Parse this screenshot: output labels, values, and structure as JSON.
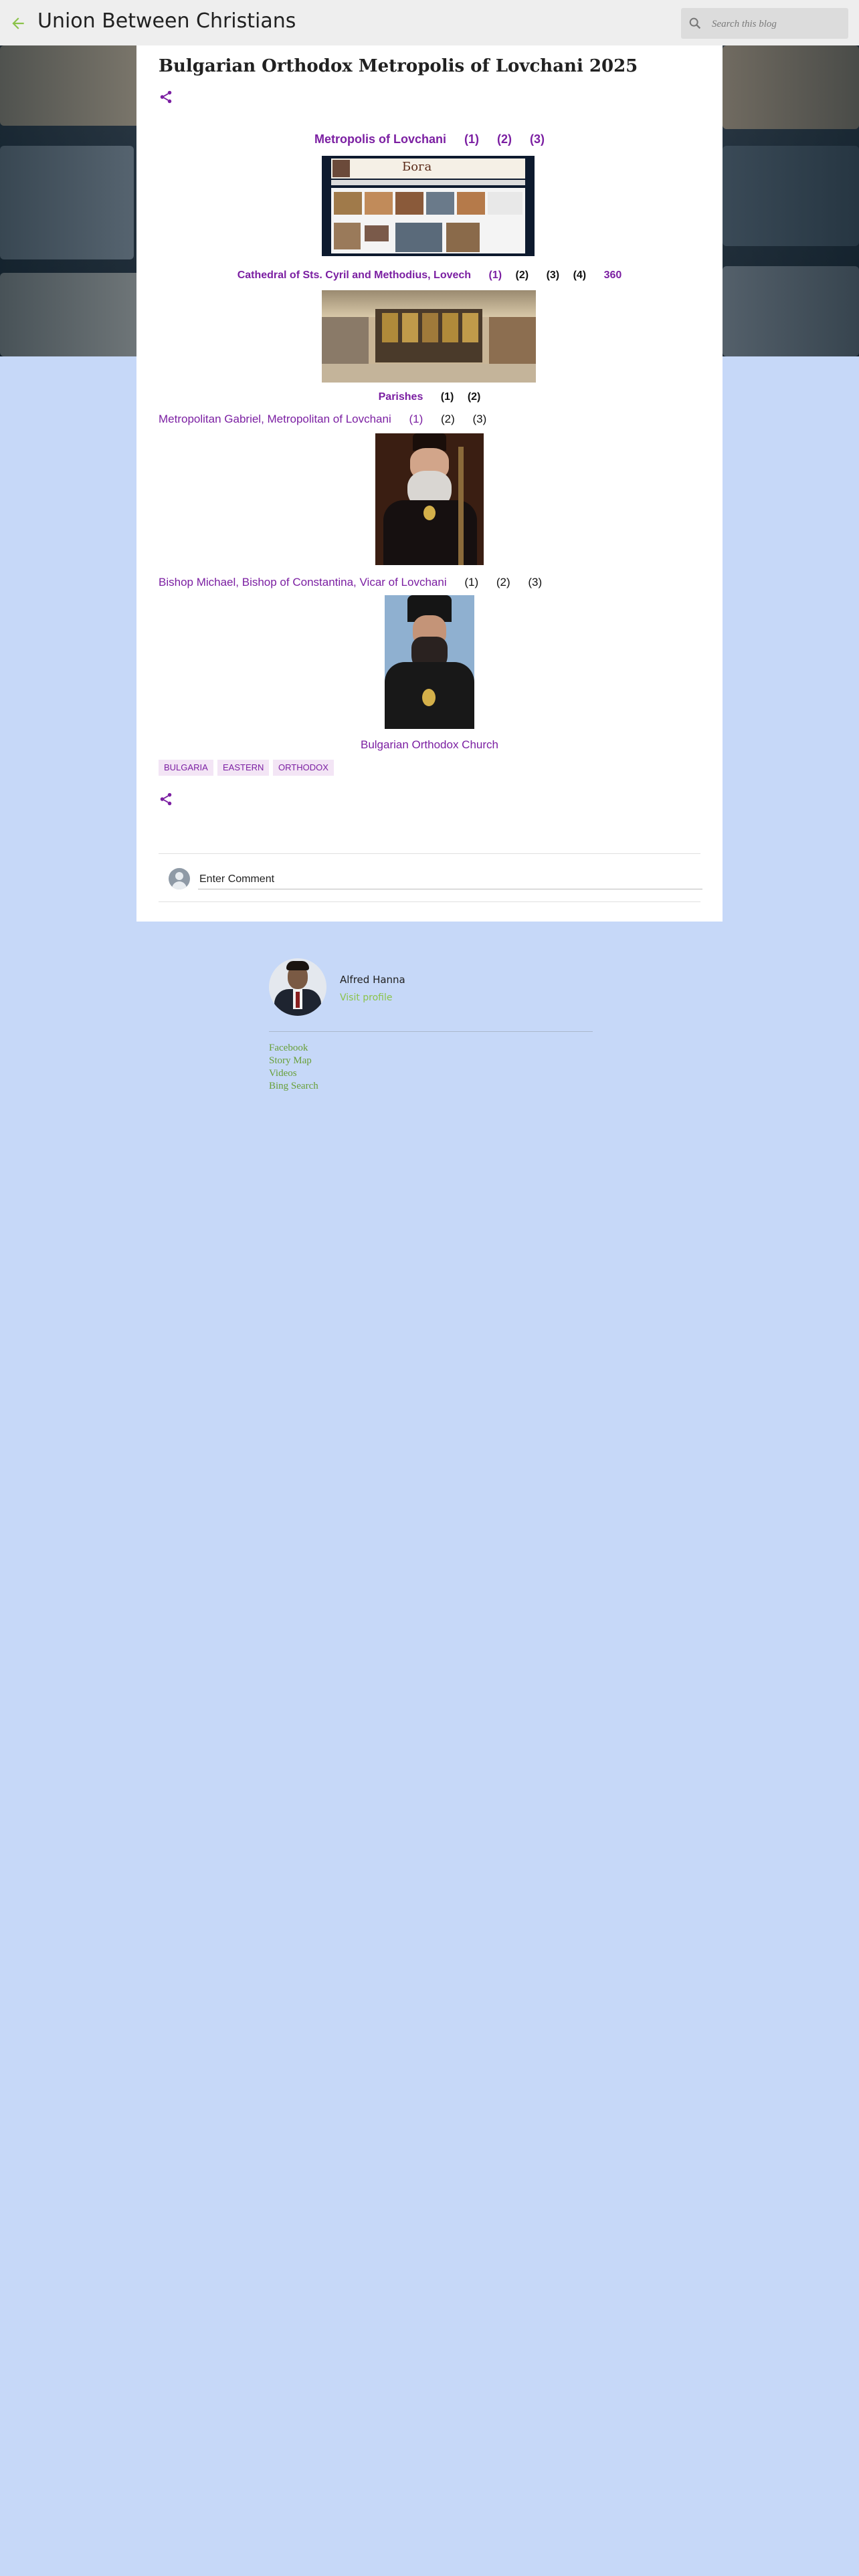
{
  "header": {
    "blog_title": "Union Between Christians",
    "search_placeholder": "Search this blog"
  },
  "post": {
    "title": "Bulgarian Orthodox Metropolis of Lovchani 2025",
    "metropolis": {
      "label": "Metropolis of Lovchani",
      "links": [
        "(1)",
        "(2)",
        "(3)"
      ]
    },
    "cathedral": {
      "label": "Cathedral of Sts. Cyril and Methodius, Lovech",
      "links": [
        "(1)",
        "(2)",
        "(3)",
        "(4)",
        "360"
      ]
    },
    "parishes": {
      "label": "Parishes",
      "links": [
        "(1)",
        "(2)"
      ]
    },
    "metropolitan": {
      "label": "Metropolitan Gabriel, Metropolitan of Lovchani",
      "links": [
        "(1)",
        "(2)",
        "(3)"
      ]
    },
    "bishop": {
      "label": "Bishop Michael, Bishop of Constantina, Vicar of Lovchani",
      "links": [
        "(1)",
        "(2)",
        "(3)"
      ]
    },
    "church_link": "Bulgarian Orthodox Church",
    "website_banner_text": "Бога",
    "labels": [
      "BULGARIA",
      "EASTERN",
      "ORTHODOX"
    ]
  },
  "comments": {
    "placeholder": "Enter Comment"
  },
  "profile": {
    "name": "Alfred Hanna",
    "visit": "Visit profile",
    "links": [
      "Facebook",
      "Story Map",
      "Videos",
      "Bing Search"
    ]
  },
  "colors": {
    "accent": "#7b1fa2",
    "link_green": "#8bc34a",
    "page_bg": "#c6d8f8"
  }
}
